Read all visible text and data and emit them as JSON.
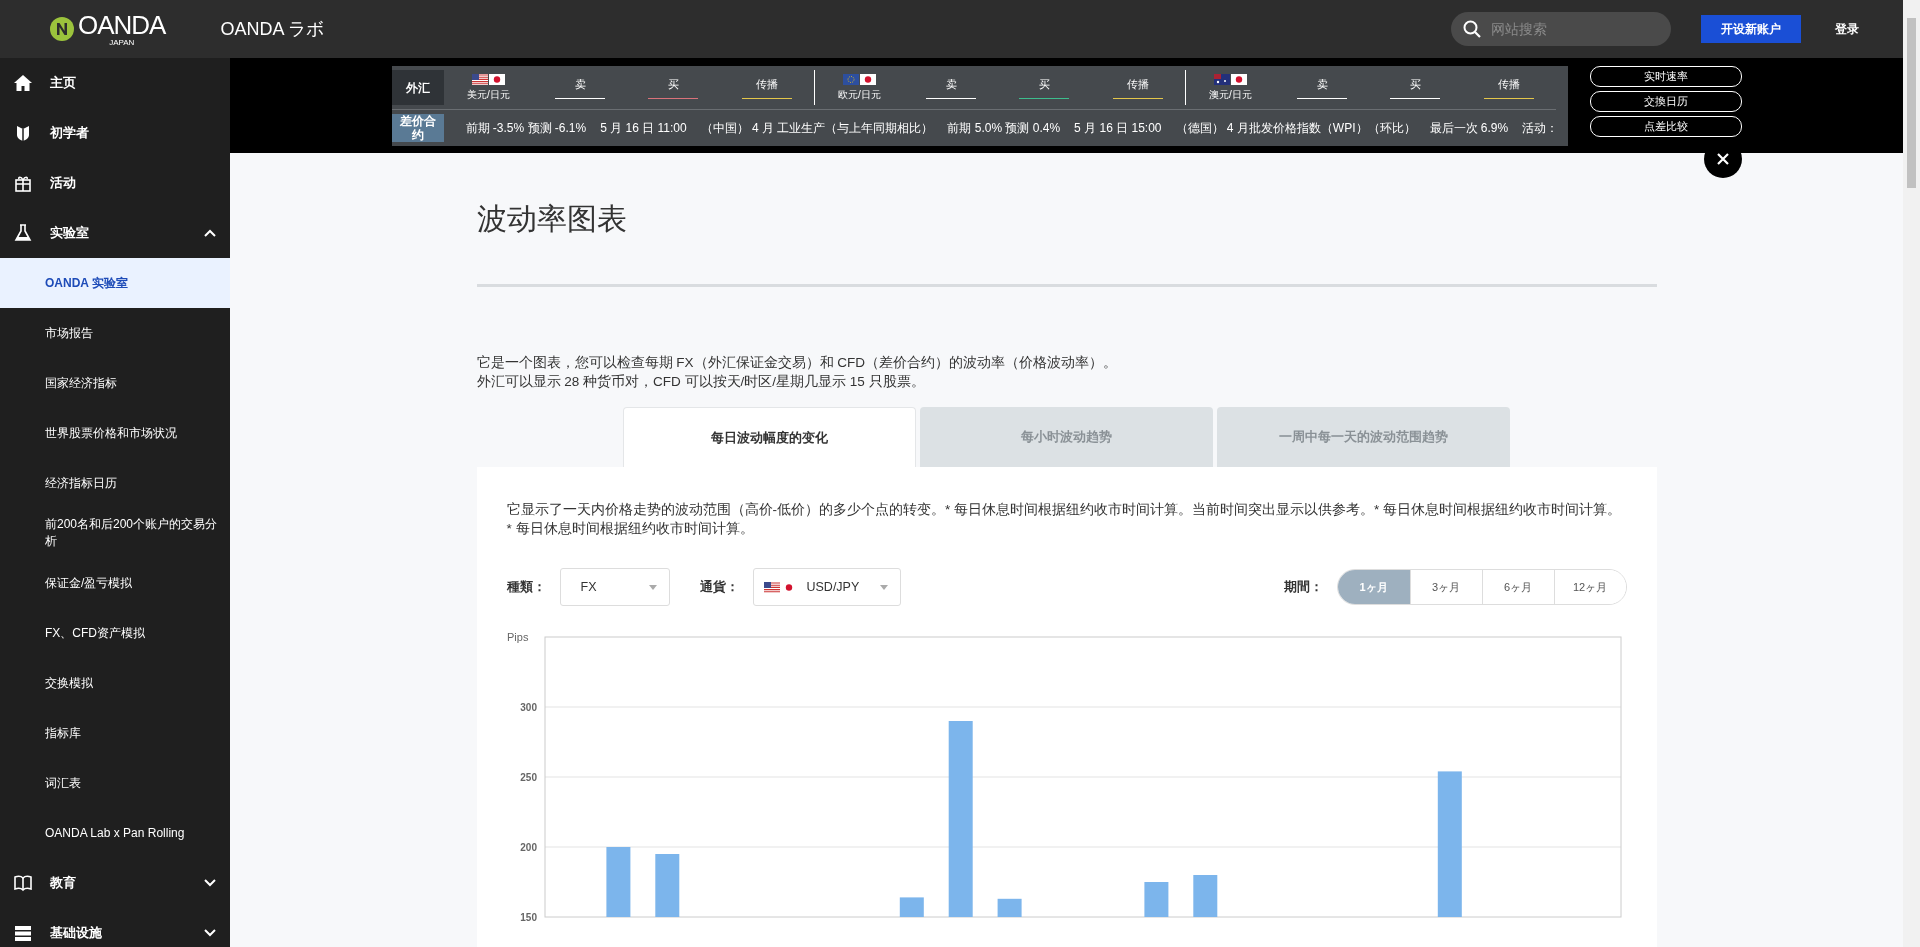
{
  "header": {
    "logo": "OANDA",
    "logo_sub": "JAPAN",
    "site_title": "OANDA ラボ",
    "search": {
      "placeholder": "网站搜索"
    },
    "buttons": [
      {
        "label": "开设新账户",
        "kind": "primary"
      },
      {
        "label": "登录",
        "kind": "link"
      }
    ]
  },
  "sidebar": {
    "items": [
      {
        "label": "主页"
      },
      {
        "label": "初学者"
      },
      {
        "label": "活动"
      },
      {
        "label": "实验室",
        "expanded": true,
        "children": [
          {
            "label": "OANDA 实验室",
            "selected": true
          },
          {
            "label": "市场报告",
            "selected": false
          },
          {
            "label": "国家经济指标",
            "selected": false
          },
          {
            "label": "世界股票价格和市场状况",
            "selected": false
          },
          {
            "label": "经济指标日历",
            "selected": false
          },
          {
            "label": "前200名和后200个账户的交易分析",
            "selected": false
          },
          {
            "label": "保证金/盈亏模拟",
            "selected": false
          },
          {
            "label": "FX、CFD资产模拟",
            "selected": false
          },
          {
            "label": "交换模拟",
            "selected": false
          },
          {
            "label": "指标库",
            "selected": false
          },
          {
            "label": "词汇表",
            "selected": false
          },
          {
            "label": "OANDA Lab x Pan Rolling",
            "selected": false
          }
        ]
      },
      {
        "label": "教育",
        "expanded": false
      },
      {
        "label": "基础设施",
        "expanded": false
      }
    ]
  },
  "ticker": {
    "forex": {
      "label": "外汇",
      "pairs": [
        {
          "name": "美元/日元",
          "quotes": [
            {
              "label": "卖",
              "color": "#ffffff"
            },
            {
              "label": "买",
              "color": "#d9727a"
            },
            {
              "label": "传播",
              "color": "#e3c64a"
            }
          ]
        },
        {
          "name": "欧元/日元",
          "quotes": [
            {
              "label": "卖",
              "color": "#ffffff"
            },
            {
              "label": "买",
              "color": "#3dbd8d"
            },
            {
              "label": "传播",
              "color": "#e3c64a"
            }
          ]
        },
        {
          "name": "澳元/日元",
          "quotes": [
            {
              "label": "卖",
              "color": "#ffffff"
            },
            {
              "label": "买",
              "color": "#ffffff"
            },
            {
              "label": "传播",
              "color": "#e3c64a"
            }
          ]
        }
      ]
    },
    "cfd": {
      "label": "差价合约",
      "items": [
        "前期 -3.5% 预测 -6.1%",
        "5 月 16 日 11:00",
        "（中国） 4 月 工业生产（与上年同期相比）",
        "前期 5.0% 预测 0.4%",
        "5 月 16 日 15:00",
        "（德国） 4 月批发价格指数（WPI）（环比）",
        "最后一次 6.9%",
        "活动："
      ]
    },
    "side_buttons": [
      "实时速率",
      "交換日历",
      "点差比较"
    ]
  },
  "page": {
    "title": "波动率图表",
    "intro": [
      "它是一个图表，您可以检查每期 FX（外汇保证金交易）和 CFD（差价合约）的波动率（价格波动率）。",
      "外汇可以显示 28 种货币对，CFD 可以按天/时区/星期几显示 15 只股票。"
    ],
    "tabs": [
      {
        "label": "每日波动幅度的变化",
        "selected": true
      },
      {
        "label": "每小时波动趋势",
        "selected": false
      },
      {
        "label": "一周中每一天的波动范围趋势",
        "selected": false
      }
    ],
    "description": [
      "它显示了一天内价格走势的波动范围（高价-低价）的多少个点的转变。* 每日休息时间根据纽约收市时间计算。当前时间突出显示以供参考。* 每日休息时间根据纽约收市时间计算。",
      "* 每日休息时间根据纽约收市时间计算。"
    ],
    "filters": {
      "type": {
        "label": "種類：",
        "value": "FX"
      },
      "currency": {
        "label": "通貨：",
        "value": "USD/JPY"
      },
      "period": {
        "label": "期間：",
        "options": [
          {
            "label": "1ヶ月",
            "selected": true
          },
          {
            "label": "3ヶ月",
            "selected": false
          },
          {
            "label": "6ヶ月",
            "selected": false
          },
          {
            "label": "12ヶ月",
            "selected": false
          }
        ]
      }
    },
    "chart": {
      "chart_data": {
        "type": "bar",
        "ylabel": "Pips",
        "ylim": [
          150,
          350
        ],
        "yticks": [
          150,
          200,
          250,
          300
        ],
        "grid": true,
        "series": [
          {
            "color": "#7cb5ec",
            "values": [
              null,
              200,
              195,
              null,
              null,
              null,
              null,
              164,
              290,
              163,
              null,
              null,
              175,
              180,
              null,
              null,
              null,
              null,
              254,
              null,
              null,
              null
            ]
          }
        ]
      }
    }
  }
}
